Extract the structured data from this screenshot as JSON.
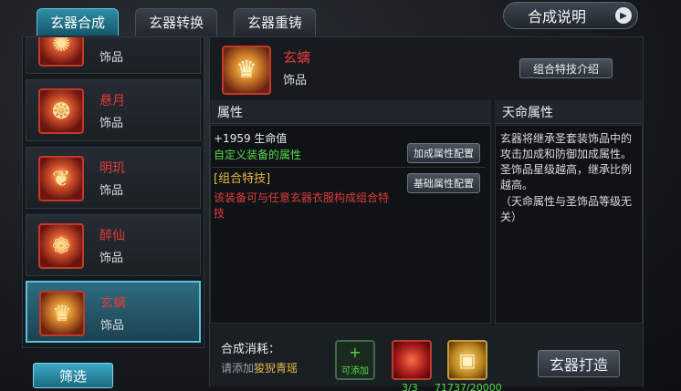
{
  "tabs": [
    {
      "label": "玄器合成",
      "active": true
    },
    {
      "label": "玄器转换",
      "active": false
    },
    {
      "label": "玄器重铸",
      "active": false
    }
  ],
  "synthesis_help_label": "合成说明",
  "items": [
    {
      "name": "",
      "type": "饰品",
      "icon": "crab-ornament-icon"
    },
    {
      "name": "悬月",
      "type": "饰品",
      "icon": "lantern-icon"
    },
    {
      "name": "明玑",
      "type": "饰品",
      "icon": "phoenix-ornament-icon"
    },
    {
      "name": "醉仙",
      "type": "饰品",
      "icon": "gourd-icon"
    },
    {
      "name": "玄螭",
      "type": "饰品",
      "icon": "dragon-seal-icon",
      "selected": true
    }
  ],
  "filter_label": "筛选",
  "selected": {
    "name": "玄螭",
    "type": "饰品"
  },
  "combo_intro_label": "组合特技介绍",
  "attributes": {
    "title": "属性",
    "hp_line": "+1959 生命值",
    "custom_attr": "自定义装备的属性",
    "add_config_label": "加成属性配置",
    "combo_title": "[组合特技]",
    "combo_desc": "该装备可与任意玄器衣服构成组合特技",
    "base_config_label": "基础属性配置"
  },
  "fate": {
    "title": "天命属性",
    "desc": "玄器将继承圣套装饰品中的攻击加成和防御加成属性。圣饰品星级越高，继承比例越高。",
    "note": "（天命属性与圣饰品等级无关）"
  },
  "cost": {
    "label": "合成消耗：",
    "hint_prefix": "请添加",
    "hint_item": "狻猊青瑶",
    "add_slot_label": "可添加",
    "orb_count": "3/3",
    "gold_count": "71737/20000"
  },
  "forge_label": "玄器打造",
  "colors": {
    "accent": "#2f8ea6",
    "red_text": "#e13b3b",
    "green_text": "#57d94b",
    "gold_text": "#e6b94a"
  }
}
